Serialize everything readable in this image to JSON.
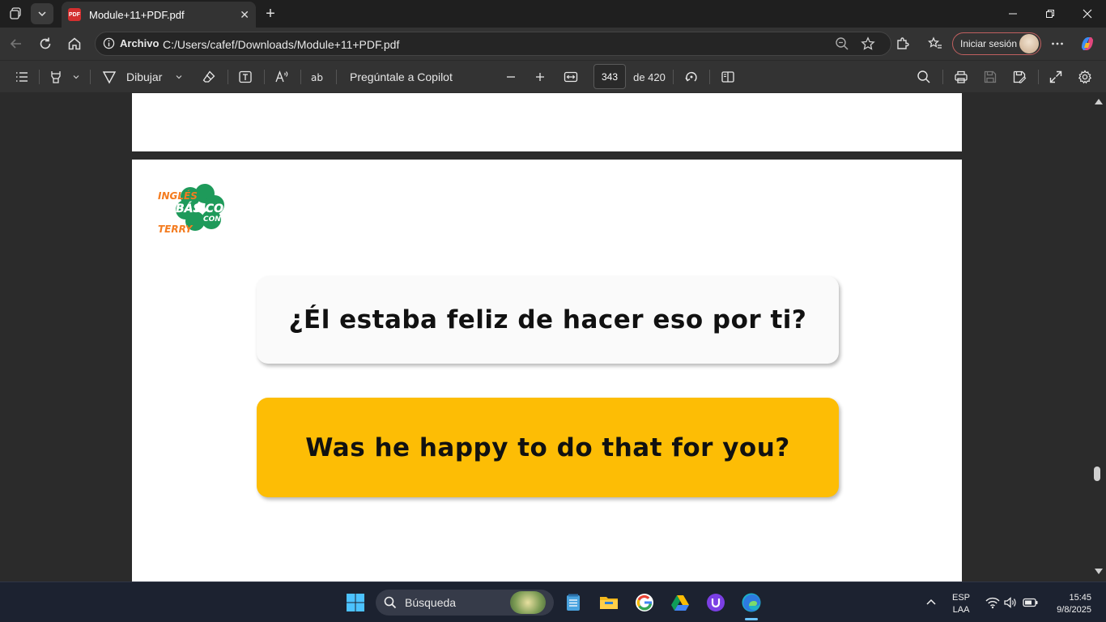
{
  "browser": {
    "tab_title": "Module+11+PDF.pdf",
    "tab_icon_text": "PDF",
    "address_label": "Archivo",
    "url": "C:/Users/cafef/Downloads/Module+11+PDF.pdf",
    "signin_label": "Iniciar sesión"
  },
  "pdf_toolbar": {
    "draw_label": "Dibujar",
    "copilot_label": "Pregúntale a Copilot",
    "current_page": "343",
    "total_pages_label": "de 420"
  },
  "document": {
    "logo_text": {
      "top": "INGLÉS",
      "middle": "BÁSICO",
      "small": "CON",
      "bottom": "TERRY"
    },
    "question_es": "¿Él estaba feliz de hacer eso por ti?",
    "answer_en": "Was he happy to do that for you?",
    "card_answer_color": "#fdbd05"
  },
  "taskbar": {
    "search_placeholder": "Búsqueda",
    "lang_top": "ESP",
    "lang_bottom": "LAA",
    "time": "15:45",
    "date": "9/8/2025"
  },
  "colors": {
    "accent": "#6ac4ff",
    "signin_border": "#c06060",
    "logo_green": "#1e9a5a",
    "logo_orange": "#f47c20"
  }
}
